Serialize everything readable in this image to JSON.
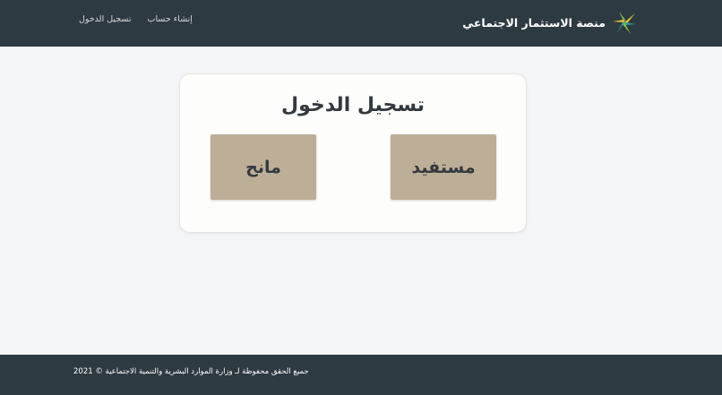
{
  "header": {
    "brand_name": "منصة الاستثمار الاجتماعي",
    "nav": {
      "login": "تسجيل الدخول",
      "register": "إنشاء حساب"
    }
  },
  "login_card": {
    "title": "تسجيل الدخول",
    "beneficiary_label": "مستفيد",
    "grantor_label": "مانح"
  },
  "footer": {
    "copyright": "جميع الحقق محفوظة لـ وزارة الموارد البشرية والتنمية الاجتماعية © 2021"
  },
  "colors": {
    "header_bg": "#2e3a41",
    "page_bg": "#f4f5f6",
    "button_bg": "#bdae98",
    "logo_yellow": "#e3c43a",
    "logo_teal": "#2aa39a",
    "logo_green": "#8fc04a"
  },
  "icons": {
    "logo": "palm-leaves-logo-icon"
  }
}
